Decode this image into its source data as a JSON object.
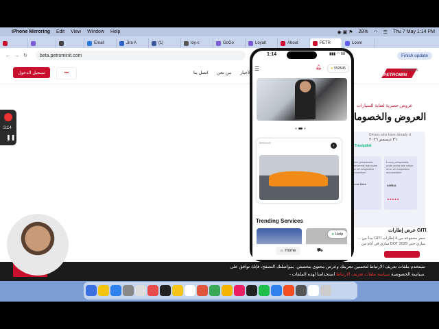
{
  "menubar": {
    "app": "iPhone Mirroring",
    "items": [
      "Edit",
      "View",
      "Window",
      "Help"
    ],
    "battery": "28%",
    "clock": "Thu 7 May  1:14 PM"
  },
  "tabs": [
    {
      "label": "",
      "color": "#c8102e"
    },
    {
      "label": "",
      "color": "#7b5cd6"
    },
    {
      "label": "",
      "color": "#444"
    },
    {
      "label": "Email",
      "color": "#2a7ae2"
    },
    {
      "label": "Jira A",
      "color": "#2a62c9"
    },
    {
      "label": "(1)",
      "color": "#3b5998"
    },
    {
      "label": "loy-c",
      "color": "#555"
    },
    {
      "label": "GoGo",
      "color": "#7b5cd6"
    },
    {
      "label": "Loyalt",
      "color": "#7b5cd6"
    },
    {
      "label": "About",
      "color": "#c8102e"
    },
    {
      "label": "PETR",
      "color": "#c8102e",
      "active": true
    },
    {
      "label": "Loom",
      "color": "#625df5"
    }
  ],
  "browser": {
    "url": "beta.petrominit.com",
    "finish": "Finish update"
  },
  "site": {
    "login": "تسجيل الدخول",
    "nav": [
      "الأخبار",
      "من نحن",
      "اتصل بنا"
    ],
    "logo_top": "EXPRESS",
    "logo_main": "PETROMIN",
    "hero_sub": "عروض حصرية لعناية السيارات",
    "hero_title": "العروض والخصوما",
    "promo_head": "Drivers who have already cl",
    "promo_date": "٣١ ديسمبر ٢٠٢٦",
    "trustpilot": "Trustpilot",
    "review_name": "Louis Baird",
    "review_brand": "AVEDA",
    "review_text": "Lorem perspiciatis unde omnis iste natus error sit voluptatem accusantium",
    "gti_title": "عرض إطارات GITI",
    "gti_body": "سعر مجموعة من 4 إطارات GITI يبدأ من ... ساري حتى DOT 2025 ساري في أيام من"
  },
  "cookie": {
    "line1": "نستخدم ملفات تعريف الارتباط لتحسين تجربتك وعرض محتوى مخصص. بمواصلتك التصفح، فإنك توافق على",
    "line2_a": "استخدامنا لهذه الملفات.",
    "line2_link": "سياسة ملفات تعريف الارتباط",
    "line2_b": "- سياسة الخصوصية"
  },
  "recorder": {
    "time": "3:14"
  },
  "phone": {
    "time": "1:14",
    "status": "▮▮▮ ◠ 68",
    "points": "552645",
    "card_tag": "NISSAN",
    "trending": "Trending Services",
    "help": "Help",
    "home": "Home"
  },
  "colors": {
    "brand_red": "#c8102e",
    "menubar": "#b9c7e3",
    "dock": "#7d9dd6"
  }
}
